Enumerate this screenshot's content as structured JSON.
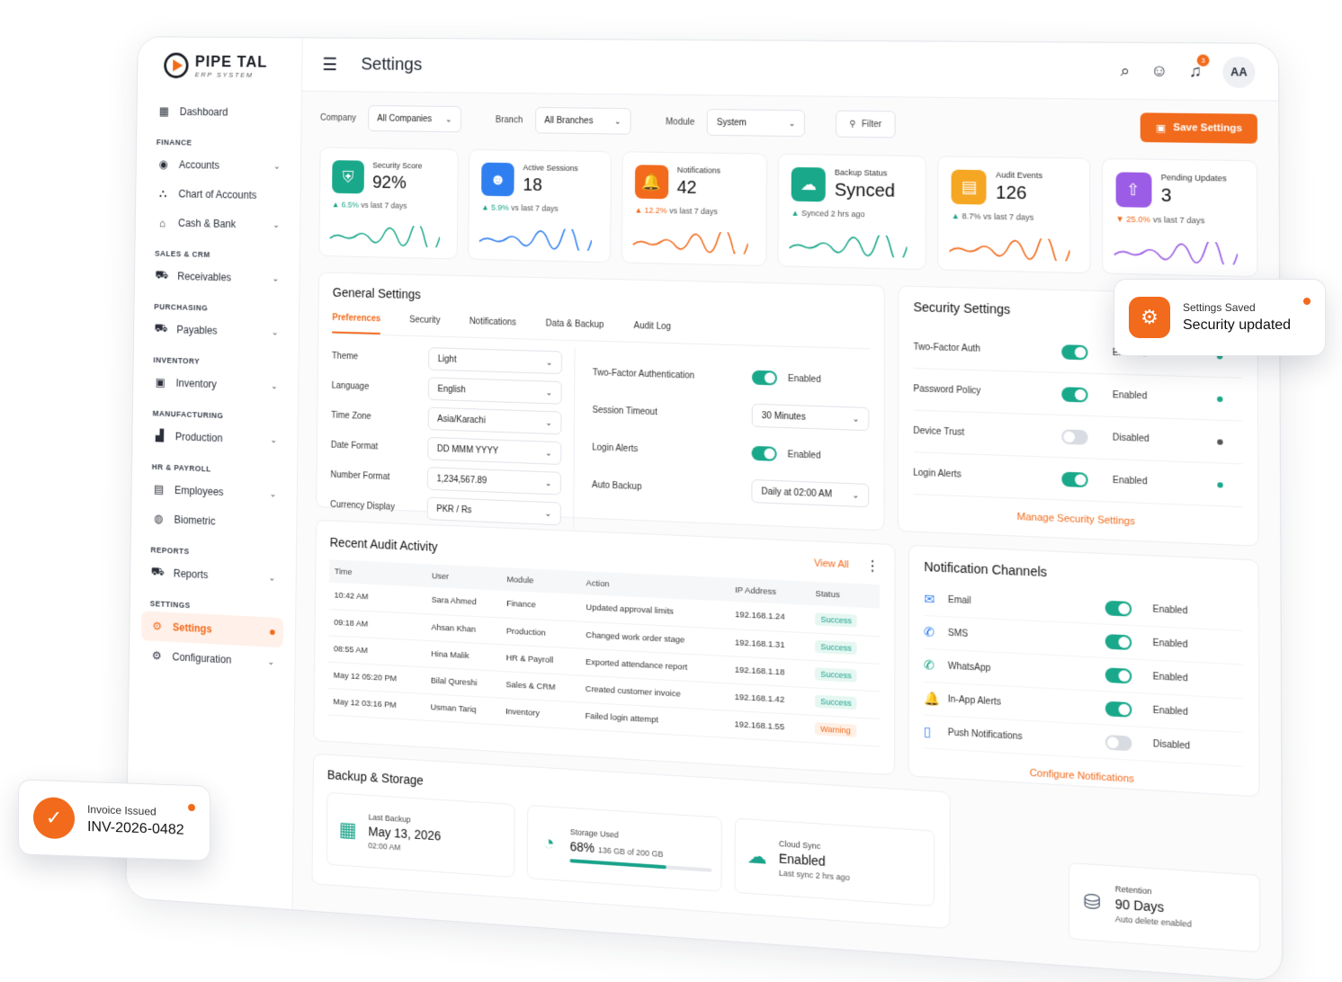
{
  "brand": {
    "name": "PIPE TAL",
    "sub": "ERP SYSTEM",
    "accent": "#f26a1b",
    "success": "#19a88a"
  },
  "header": {
    "title": "Settings",
    "notif_count": "3",
    "avatar": "AA"
  },
  "sidebar": {
    "dashboard": "Dashboard",
    "sections": [
      {
        "title": "FINANCE",
        "items": [
          "Accounts",
          "Chart of Accounts",
          "Cash & Bank"
        ]
      },
      {
        "title": "SALES & CRM",
        "items": [
          "Receivables"
        ]
      },
      {
        "title": "PURCHASING",
        "items": [
          "Payables"
        ]
      },
      {
        "title": "INVENTORY",
        "items": [
          "Inventory"
        ]
      },
      {
        "title": "MANUFACTURING",
        "items": [
          "Production"
        ]
      },
      {
        "title": "HR & PAYROLL",
        "items": [
          "Employees",
          "Biometric"
        ]
      },
      {
        "title": "REPORTS",
        "items": [
          "Reports"
        ]
      },
      {
        "title": "SETTINGS",
        "items": [
          "Settings",
          "Configuration"
        ]
      }
    ]
  },
  "filters": {
    "company_label": "Company",
    "company_value": "All Companies",
    "branch_label": "Branch",
    "branch_value": "All Branches",
    "module_label": "Module",
    "module_value": "System",
    "filter_btn": "Filter",
    "save_btn": "Save Settings"
  },
  "kpis": [
    {
      "label": "Security Score",
      "value": "92%",
      "pct": "6.5%",
      "trend": "vs last 7 days",
      "dir": "up",
      "color": "#19a88a",
      "icon": "shield-icon"
    },
    {
      "label": "Active Sessions",
      "value": "18",
      "pct": "5.9%",
      "trend": "vs last 7 days",
      "dir": "up",
      "color": "#2f7ff0",
      "icon": "user-icon"
    },
    {
      "label": "Notifications",
      "value": "42",
      "pct": "12.2%",
      "trend": "vs last 7 days",
      "dir": "up-warn",
      "color": "#f26a1b",
      "icon": "bell-icon"
    },
    {
      "label": "Backup Status",
      "value": "Synced",
      "pct": "",
      "trend": "Synced 2 hrs ago",
      "dir": "up",
      "color": "#19a88a",
      "icon": "cloud-icon"
    },
    {
      "label": "Audit Events",
      "value": "126",
      "pct": "",
      "trend": "8.7% vs last 7 days",
      "dir": "up-neutral",
      "color": "#f5a623",
      "icon": "document-icon"
    },
    {
      "label": "Pending Updates",
      "value": "3",
      "pct": "25.0%",
      "trend": "vs last 7 days",
      "dir": "down",
      "color": "#9b5de5",
      "icon": "upload-icon"
    }
  ],
  "general": {
    "title": "General Settings",
    "tabs": [
      "Preferences",
      "Security",
      "Notifications",
      "Data & Backup",
      "Audit Log"
    ],
    "prefs": [
      {
        "label": "Theme",
        "value": "Light"
      },
      {
        "label": "Language",
        "value": "English"
      },
      {
        "label": "Time Zone",
        "value": "Asia/Karachi"
      },
      {
        "label": "Date Format",
        "value": "DD MMM YYYY"
      },
      {
        "label": "Number Format",
        "value": "1,234,567.89"
      },
      {
        "label": "Currency Display",
        "value": "PKR / Rs"
      }
    ],
    "right": [
      {
        "label": "Two-Factor Authentication",
        "value": "Enabled"
      },
      {
        "label": "Session Timeout",
        "value": "30 Minutes"
      },
      {
        "label": "Login Alerts",
        "value": "Enabled"
      },
      {
        "label": "Auto Backup",
        "value": "Daily at 02:00 AM"
      }
    ]
  },
  "security": {
    "title": "Security Settings",
    "rows": [
      {
        "label": "Two-Factor Auth",
        "value": "Enabled",
        "on": true
      },
      {
        "label": "Password Policy",
        "value": "Enabled",
        "on": true
      },
      {
        "label": "Device Trust",
        "value": "Disabled",
        "on": false
      },
      {
        "label": "Login Alerts",
        "value": "Enabled",
        "on": true
      }
    ],
    "link": "Manage Security Settings"
  },
  "audit": {
    "title": "Recent Audit Activity",
    "view_all": "View All",
    "columns": [
      "Time",
      "User",
      "Module",
      "Action",
      "IP Address",
      "Status"
    ],
    "rows": [
      [
        "10:42 AM",
        "Sara Ahmed",
        "Finance",
        "Updated approval limits",
        "192.168.1.24",
        "Success"
      ],
      [
        "09:18 AM",
        "Ahsan Khan",
        "Production",
        "Changed work order stage",
        "192.168.1.31",
        "Success"
      ],
      [
        "08:55 AM",
        "Hina Malik",
        "HR & Payroll",
        "Exported attendance report",
        "192.168.1.18",
        "Success"
      ],
      [
        "May 12 05:20 PM",
        "Bilal Qureshi",
        "Sales & CRM",
        "Created customer invoice",
        "192.168.1.42",
        "Success"
      ],
      [
        "May 12 03:16 PM",
        "Usman Tariq",
        "Inventory",
        "Failed login attempt",
        "192.168.1.55",
        "Warning"
      ]
    ]
  },
  "channels": {
    "title": "Notification Channels",
    "rows": [
      {
        "label": "Email",
        "value": "Enabled",
        "on": true,
        "icon": "mail-icon"
      },
      {
        "label": "SMS",
        "value": "Enabled",
        "on": true,
        "icon": "chat-icon"
      },
      {
        "label": "WhatsApp",
        "value": "Enabled",
        "on": true,
        "icon": "whatsapp-icon"
      },
      {
        "label": "In-App Alerts",
        "value": "Enabled",
        "on": true,
        "icon": "bell-icon"
      },
      {
        "label": "Push Notifications",
        "value": "Disabled",
        "on": false,
        "icon": "phone-icon"
      }
    ],
    "link": "Configure Notifications"
  },
  "backup": {
    "title": "Backup & Storage",
    "last_label": "Last Backup",
    "last_value": "May 13, 2026",
    "last_sub": "02:00 AM",
    "storage_label": "Storage Used",
    "storage_value": "68%",
    "storage_sub": "136 GB of 200 GB",
    "storage_fill": 0.68,
    "cloud_label": "Cloud Sync",
    "cloud_value": "Enabled",
    "cloud_sub": "Last sync 2 hrs ago",
    "ret_label": "Retention",
    "ret_value": "90 Days",
    "ret_sub": "Auto delete enabled"
  },
  "toasts": {
    "saved_title": "Settings Saved",
    "saved_msg": "Security updated",
    "invoice_title": "Invoice Issued",
    "invoice_msg": "INV-2026-0482"
  }
}
